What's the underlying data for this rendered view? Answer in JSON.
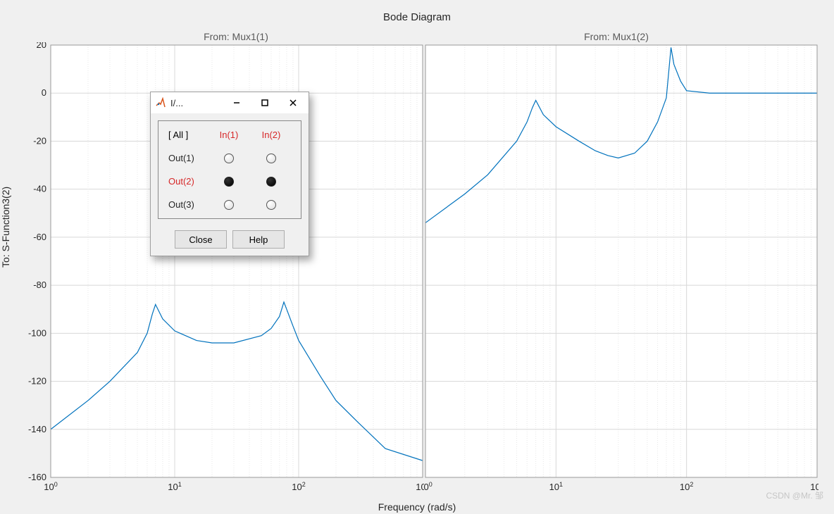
{
  "title": "Bode Diagram",
  "subtitles": [
    "From: Mux1(1)",
    "From: Mux1(2)"
  ],
  "ylabel": "To: S-Function3(2)",
  "xlabel": "Frequency  (rad/s)",
  "watermark": "CSDN @Mr. 邹",
  "dialog": {
    "title": "I/...",
    "all_label": "[ All ]",
    "col_headers": [
      "In(1)",
      "In(2)"
    ],
    "rows": [
      {
        "label": "Out(1)",
        "sel": false,
        "vals": [
          false,
          false
        ]
      },
      {
        "label": "Out(2)",
        "sel": true,
        "vals": [
          true,
          true
        ]
      },
      {
        "label": "Out(3)",
        "sel": false,
        "vals": [
          false,
          false
        ]
      }
    ],
    "close_label": "Close",
    "help_label": "Help"
  },
  "chart_data": [
    {
      "type": "line",
      "title": "From: Mux1(1)",
      "xlabel": "Frequency  (rad/s)",
      "ylabel": "To: S-Function3(2)",
      "xlim": [
        1,
        1000
      ],
      "ylim": [
        -160,
        20
      ],
      "xscale": "log",
      "grid": true,
      "series": [
        {
          "name": "Out(2)",
          "x": [
            1,
            2,
            3,
            5,
            6,
            6.6,
            7,
            8,
            10,
            15,
            20,
            30,
            50,
            60,
            70,
            76,
            80,
            90,
            100,
            150,
            200,
            300,
            500,
            1000
          ],
          "values": [
            -140,
            -128,
            -120,
            -108,
            -100,
            -92,
            -88,
            -94,
            -99,
            -103,
            -104,
            -104,
            -101,
            -98,
            -93,
            -87,
            -90,
            -97,
            -103,
            -118,
            -128,
            -137,
            -148,
            -153
          ]
        }
      ]
    },
    {
      "type": "line",
      "title": "From: Mux1(2)",
      "xlabel": "Frequency  (rad/s)",
      "ylabel": "",
      "xlim": [
        1,
        1000
      ],
      "ylim": [
        -160,
        20
      ],
      "xscale": "log",
      "grid": true,
      "series": [
        {
          "name": "Out(2)",
          "x": [
            1,
            2,
            3,
            5,
            6,
            6.6,
            7,
            8,
            10,
            15,
            20,
            25,
            30,
            40,
            50,
            60,
            70,
            76,
            80,
            90,
            100,
            150,
            200,
            300,
            500,
            1000
          ],
          "values": [
            -54,
            -42,
            -34,
            -20,
            -12,
            -6,
            -3,
            -9,
            -14,
            -20,
            -24,
            -26,
            -27,
            -25,
            -20,
            -12,
            -2,
            19,
            12,
            5,
            1,
            0,
            0,
            0,
            0,
            0
          ]
        }
      ]
    }
  ]
}
